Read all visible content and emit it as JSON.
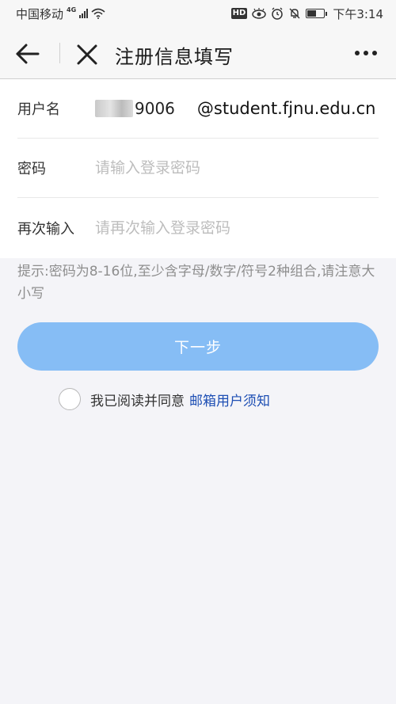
{
  "status_bar": {
    "carrier": "中国移动",
    "network": "4G",
    "time": "下午3:14",
    "hd_label": "HD",
    "icons": [
      "signal-icon",
      "wifi-icon",
      "hd-icon",
      "eye-icon",
      "alarm-icon",
      "mute-icon",
      "battery-icon"
    ]
  },
  "header": {
    "title": "注册信息填写",
    "back_icon": "back-arrow-icon",
    "close_icon": "close-icon",
    "more_icon": "more-dots-icon"
  },
  "form": {
    "username": {
      "label": "用户名",
      "value_visible": "9006",
      "suffix": "@student.fjnu.edu.cn"
    },
    "password": {
      "label": "密码",
      "placeholder": "请输入登录密码",
      "value": ""
    },
    "password_confirm": {
      "label": "再次输入",
      "placeholder": "请再次输入登录密码",
      "value": ""
    }
  },
  "hint": "提示:密码为8-16位,至少含字母/数字/符号2种组合,请注意大小写",
  "next_button": {
    "label": "下一步",
    "color": "#86bdf5"
  },
  "agreement": {
    "checked": false,
    "text": "我已阅读并同意",
    "link": "邮箱用户须知",
    "link_color": "#1e4fb4"
  }
}
